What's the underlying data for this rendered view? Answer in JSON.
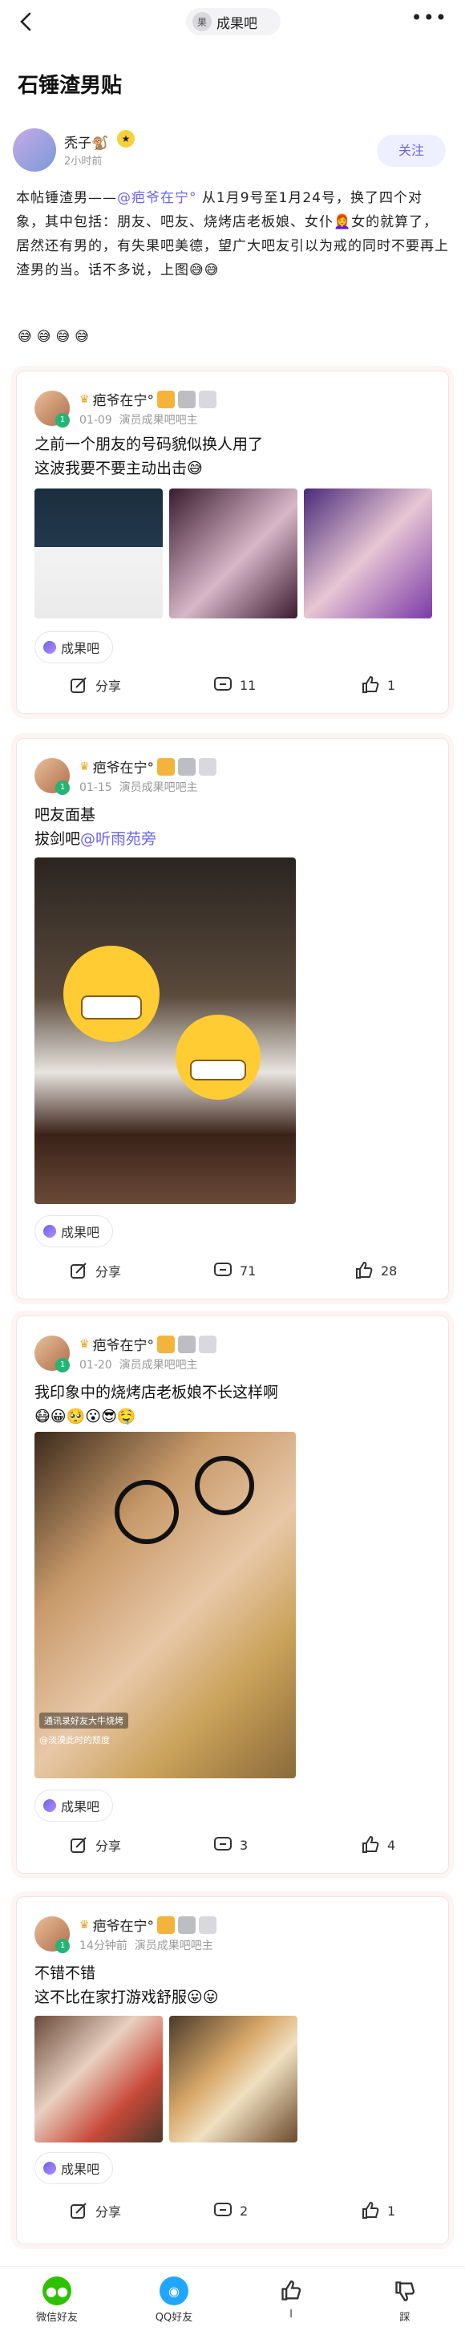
{
  "header": {
    "forum_name": "成果吧"
  },
  "post": {
    "title": "石锤渣男贴",
    "author": {
      "name": "秃子🐒",
      "time": "2小时前",
      "follow_label": "关注"
    },
    "body_pre": "本帖锤渣男——",
    "body_mention": "@疤爷在宁°",
    "body_post": " 从1月9号至1月24号，换了四个对象，其中包括：朋友、吧友、烧烤店老板娘、女仆👩‍🦰女的就算了，居然还有男的，有失果吧美德，望广大吧友引以为戒的同时不要再上渣男的当。话不多说，上图😅😅",
    "emoji_row": "😅😅😅😅"
  },
  "replies": [
    {
      "name": "疤爷在宁°",
      "date": "01-09",
      "role": "演员成果吧吧主",
      "text_lines": [
        "之前一个朋友的号码貌似换人用了",
        "这波我要不要主动出击😅"
      ],
      "tag": "成果吧",
      "share": "分享",
      "comments": "11",
      "likes": "1"
    },
    {
      "name": "疤爷在宁°",
      "date": "01-15",
      "role": "演员成果吧吧主",
      "text_line1": "吧友面基",
      "text_line2_pre": "拔剑吧",
      "text_line2_mention": "@听雨苑旁",
      "tag": "成果吧",
      "share": "分享",
      "comments": "71",
      "likes": "28"
    },
    {
      "name": "疤爷在宁°",
      "date": "01-20",
      "role": "演员成果吧吧主",
      "text_lines": [
        "我印象中的烧烤店老板娘不长这样啊",
        "😷😀🥺😮😎🤤"
      ],
      "tag": "成果吧",
      "share": "分享",
      "comments": "3",
      "likes": "4",
      "image_caption1": "通讯录好友大牛烧烤",
      "image_caption2": "@淡漠此时的颓度"
    },
    {
      "name": "疤爷在宁°",
      "date": "14分钟前",
      "role": "演员成果吧吧主",
      "text_lines": [
        "不错不错",
        "这不比在家打游戏舒服😛😛"
      ],
      "tag": "成果吧",
      "share": "分享",
      "comments": "2",
      "likes": "1"
    }
  ],
  "bottom": {
    "wechat": "微信好友",
    "qq": "QQ好友",
    "like": "l",
    "dislike": "踩"
  },
  "colors": {
    "accent": "#6a63f0",
    "wechat": "#2dc100",
    "qq": "#1fa7ff"
  }
}
